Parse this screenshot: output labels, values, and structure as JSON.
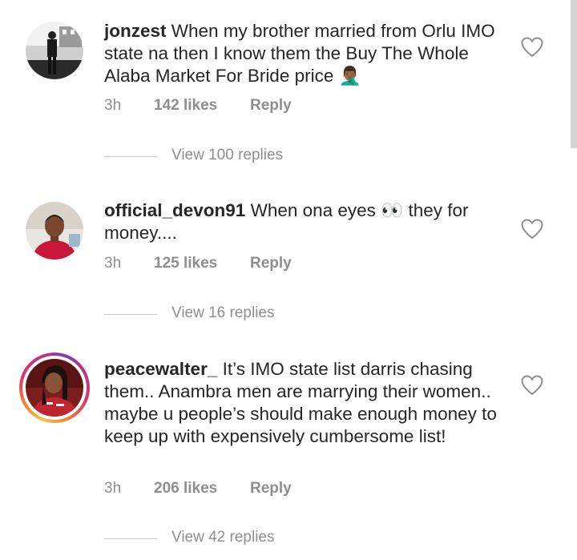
{
  "comments": [
    {
      "username": "jonzest",
      "text": "When my brother married from Orlu IMO state na then I know them the Buy The Whole Alaba Market For Bride price 🤦🏾‍♂️",
      "time": "3h",
      "likes": "142 likes",
      "reply_label": "Reply",
      "view_replies": "View 100 replies",
      "has_story_ring": false
    },
    {
      "username": "official_devon91",
      "text": "When ona eyes 👀 they for money....",
      "time": "3h",
      "likes": "125 likes",
      "reply_label": "Reply",
      "view_replies": "View 16 replies",
      "has_story_ring": false
    },
    {
      "username": "peacewalter_",
      "text": "It’s IMO state list darris chasing them.. Anambra  men are marrying their women.. maybe u people’s should make enough money to keep up with expensively cumbersome list!",
      "time": "3h",
      "likes": "206 likes",
      "reply_label": "Reply",
      "view_replies": "View 42 replies",
      "has_story_ring": true
    }
  ],
  "colors": {
    "text": "#262626",
    "secondary": "#8e8e8e",
    "divider": "#c7c7c7"
  },
  "icons": {
    "like": "heart-outline-icon"
  }
}
